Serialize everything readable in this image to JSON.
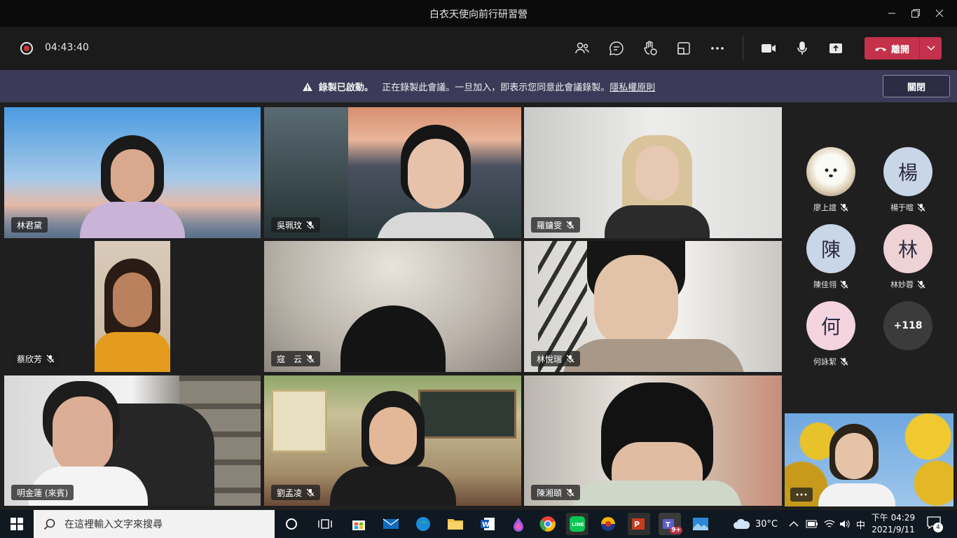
{
  "window": {
    "title": "白衣天使向前行研習營"
  },
  "toolbar": {
    "timer": "04:43:40",
    "leave_label": "離開"
  },
  "banner": {
    "strong": "錄製已啟動。",
    "text": "正在錄製此會議。一旦加入，即表示您同意此會議錄製。",
    "link": "隱私權原則",
    "dismiss": "關閉"
  },
  "participants": [
    {
      "name": "林君黛",
      "muted": false,
      "active": true
    },
    {
      "name": "吳珮玟",
      "muted": true
    },
    {
      "name": "羅鏞雯",
      "muted": true
    },
    {
      "name": "蔡欣芳",
      "muted": true
    },
    {
      "name": "寇　云",
      "muted": true
    },
    {
      "name": "林悅瑞",
      "muted": true
    },
    {
      "name": "明金蓮 (來賓)",
      "muted": false,
      "active": true
    },
    {
      "name": "劉孟凌",
      "muted": true
    },
    {
      "name": "陳湘頤",
      "muted": true
    }
  ],
  "roster": [
    {
      "name": "廖上誼",
      "initial": "",
      "color": "#e8dcc6"
    },
    {
      "name": "楊于暄",
      "initial": "楊",
      "color": "#c9d6e8"
    },
    {
      "name": "陳佳翎",
      "initial": "陳",
      "color": "#c9d6e8"
    },
    {
      "name": "林妙蓉",
      "initial": "林",
      "color": "#efd2d6"
    },
    {
      "name": "何詠絜",
      "initial": "何",
      "color": "#f3d4df"
    }
  ],
  "overflow": "+118",
  "taskbar": {
    "search_placeholder": "在這裡輸入文字來搜尋",
    "weather": "30°C",
    "ime": "中",
    "time": "下午 04:29",
    "date": "2021/9/11",
    "notifications": "4",
    "teams_badge": "9+"
  },
  "colors": {
    "leave": "#c4314b",
    "banner": "#3b3a58",
    "active_outline": "#9ea2ff"
  }
}
